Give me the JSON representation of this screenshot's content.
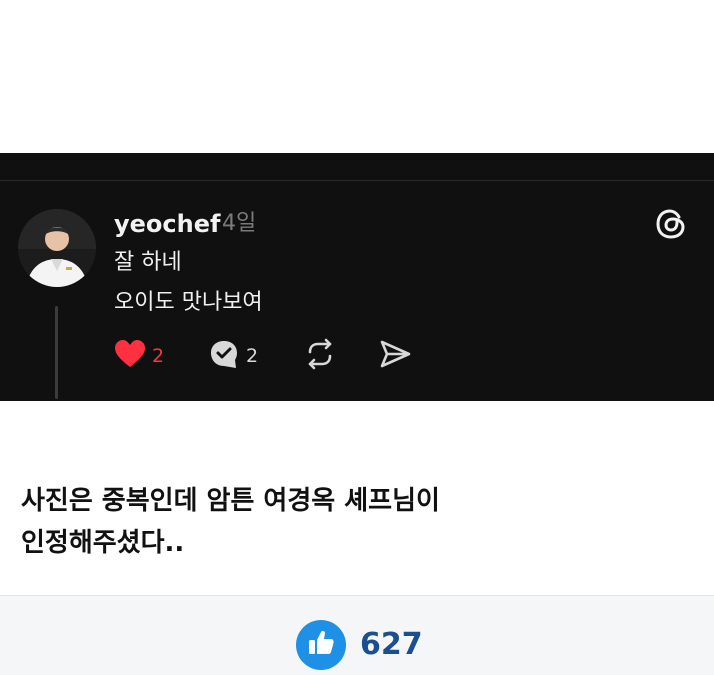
{
  "post": {
    "username": "yeochef",
    "time_ago": "4일",
    "line1": "잘 하네",
    "line2": "오이도 맛나보여",
    "like_count": "2",
    "reply_count": "2"
  },
  "caption": {
    "line1": "사진은 중복인데 암튼 여경옥 셰프님이",
    "line2": "인정해주셨다.."
  },
  "footer": {
    "like_total": "627"
  },
  "icons": {
    "avatar": "profile-photo",
    "threads": "threads-logo-icon",
    "like": "heart-icon",
    "reply": "comment-icon",
    "repost": "repost-icon",
    "share": "send-icon",
    "thumbs": "thumbs-up-icon"
  },
  "colors": {
    "card_bg": "#101010",
    "like_red": "#ff3040",
    "footer_blue": "#1e90e6",
    "count_navy": "#1b4f8f"
  }
}
